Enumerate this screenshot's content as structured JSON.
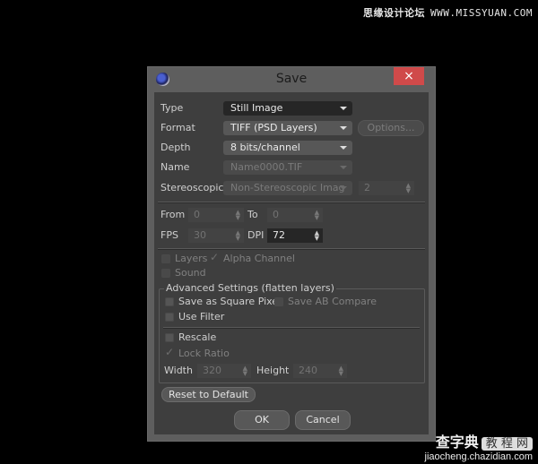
{
  "watermarks": {
    "top_cn": "思缘设计论坛",
    "top_url": "WWW.MISSYUAN.COM",
    "bottom_cn": "查字典",
    "bottom_box": "教 程 网",
    "bottom_url": "jiaocheng.chazidian.com"
  },
  "dialog": {
    "title": "Save",
    "close_icon": "×",
    "type": {
      "label": "Type",
      "value": "Still Image"
    },
    "format": {
      "label": "Format",
      "value": "TIFF (PSD Layers)"
    },
    "options_button": "Options...",
    "depth": {
      "label": "Depth",
      "value": "8 bits/channel"
    },
    "name": {
      "label": "Name",
      "value": "Name0000.TIF"
    },
    "stereoscopic": {
      "label": "Stereoscopic",
      "value": "Non-Stereoscopic Imag",
      "count": "2"
    },
    "from": {
      "label": "From",
      "value": "0"
    },
    "to": {
      "label": "To",
      "value": "0"
    },
    "fps": {
      "label": "FPS",
      "value": "30"
    },
    "dpi": {
      "label": "DPI",
      "value": "72"
    },
    "layers": {
      "label": "Layers",
      "checked": false
    },
    "alpha_channel": {
      "label": "Alpha Channel",
      "checked": true
    },
    "sound": {
      "label": "Sound",
      "checked": false
    },
    "advanced": {
      "title": "Advanced Settings (flatten layers)",
      "square_pixel": {
        "label": "Save as Square Pixel",
        "checked": false
      },
      "ab_compare": {
        "label": "Save AB Compare",
        "checked": false
      },
      "use_filter": {
        "label": "Use Filter",
        "checked": false
      },
      "rescale": {
        "label": "Rescale",
        "checked": false
      },
      "lock_ratio": {
        "label": "Lock Ratio",
        "checked": true
      },
      "width": {
        "label": "Width",
        "value": "320"
      },
      "height": {
        "label": "Height",
        "value": "240"
      }
    },
    "reset_button": "Reset to Default",
    "ok_button": "OK",
    "cancel_button": "Cancel"
  },
  "colors": {
    "close_button": "#d04a4a",
    "dialog_bg": "#5e5e5e",
    "panel_bg": "#3e3e3e"
  }
}
